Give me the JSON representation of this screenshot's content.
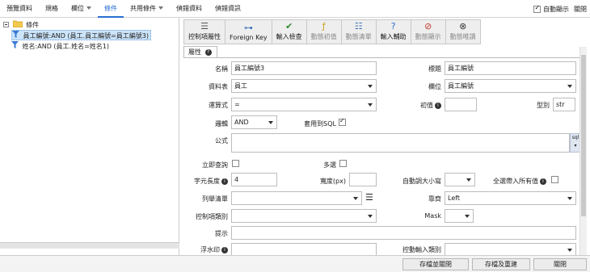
{
  "menu": {
    "tabs": [
      "預覽資料",
      "規格",
      "欄位",
      "條件",
      "共用條件",
      "偵錯資料",
      "偵錯資訊"
    ],
    "dropdown_tabs": [
      2,
      4
    ],
    "active": 3,
    "auto_show_label": "自動顯示",
    "close_label": "關閉"
  },
  "tree": {
    "root": "條件",
    "items": [
      "員工編號:AND (員工.員工編號=員工編號3)",
      "姓名:AND (員工.姓名=姓名1)"
    ]
  },
  "toolbar": [
    {
      "icon": "list-icon",
      "glyph": "☰",
      "label": "控制項屬性",
      "enabled": true
    },
    {
      "icon": "key-icon",
      "glyph": "⊶",
      "label": "Foreign Key",
      "enabled": true
    },
    {
      "icon": "check-icon",
      "glyph": "✔",
      "label": "輸入檢查",
      "enabled": true
    },
    {
      "icon": "function-icon",
      "glyph": "ƒ",
      "label": "動態初值",
      "enabled": false
    },
    {
      "icon": "bullet-list-icon",
      "glyph": "☷",
      "label": "動態清單",
      "enabled": false
    },
    {
      "icon": "help-icon",
      "glyph": "?",
      "label": "輸入輔助",
      "enabled": true
    },
    {
      "icon": "eye-off-icon",
      "glyph": "⊘",
      "label": "動態顯示",
      "enabled": false
    },
    {
      "icon": "block-icon",
      "glyph": "⊗",
      "label": "動態唯讀",
      "enabled": false
    }
  ],
  "attr_tab": "屬性",
  "form": {
    "name_label": "名稱",
    "name_value": "員工編號3",
    "title_label": "標題",
    "title_value": "員工編號",
    "table_label": "資料表",
    "table_value": "員工",
    "field_label": "欄位",
    "field_value": "員工編號",
    "op_label": "運算式",
    "op_value": "=",
    "init_label": "初值",
    "type_label": "型別",
    "type_value": "str",
    "logic_label": "邏輯",
    "logic_value": "AND",
    "apply_sql_label": "套用到SQL",
    "formula_label": "公式",
    "sql_badge": "sql",
    "immediate_label": "立即查詢",
    "multi_label": "多選",
    "len_label": "字元長度",
    "len_value": "4",
    "width_label": "寬度(px)",
    "autosize_label": "自動調大小寫",
    "all_label": "全選帶入所有值",
    "enum_label": "列舉清單",
    "align_label": "靠齊",
    "align_value": "Left",
    "ctrl_label": "控制項類別",
    "mask_label": "Mask",
    "hint_label": "提示",
    "extra_left_label": "浮水印",
    "extra_right_label": "控動輸入類別"
  },
  "footer": {
    "save_close": "存檔並關閉",
    "save_rebuild": "存檔及重建",
    "close": "關閉"
  }
}
